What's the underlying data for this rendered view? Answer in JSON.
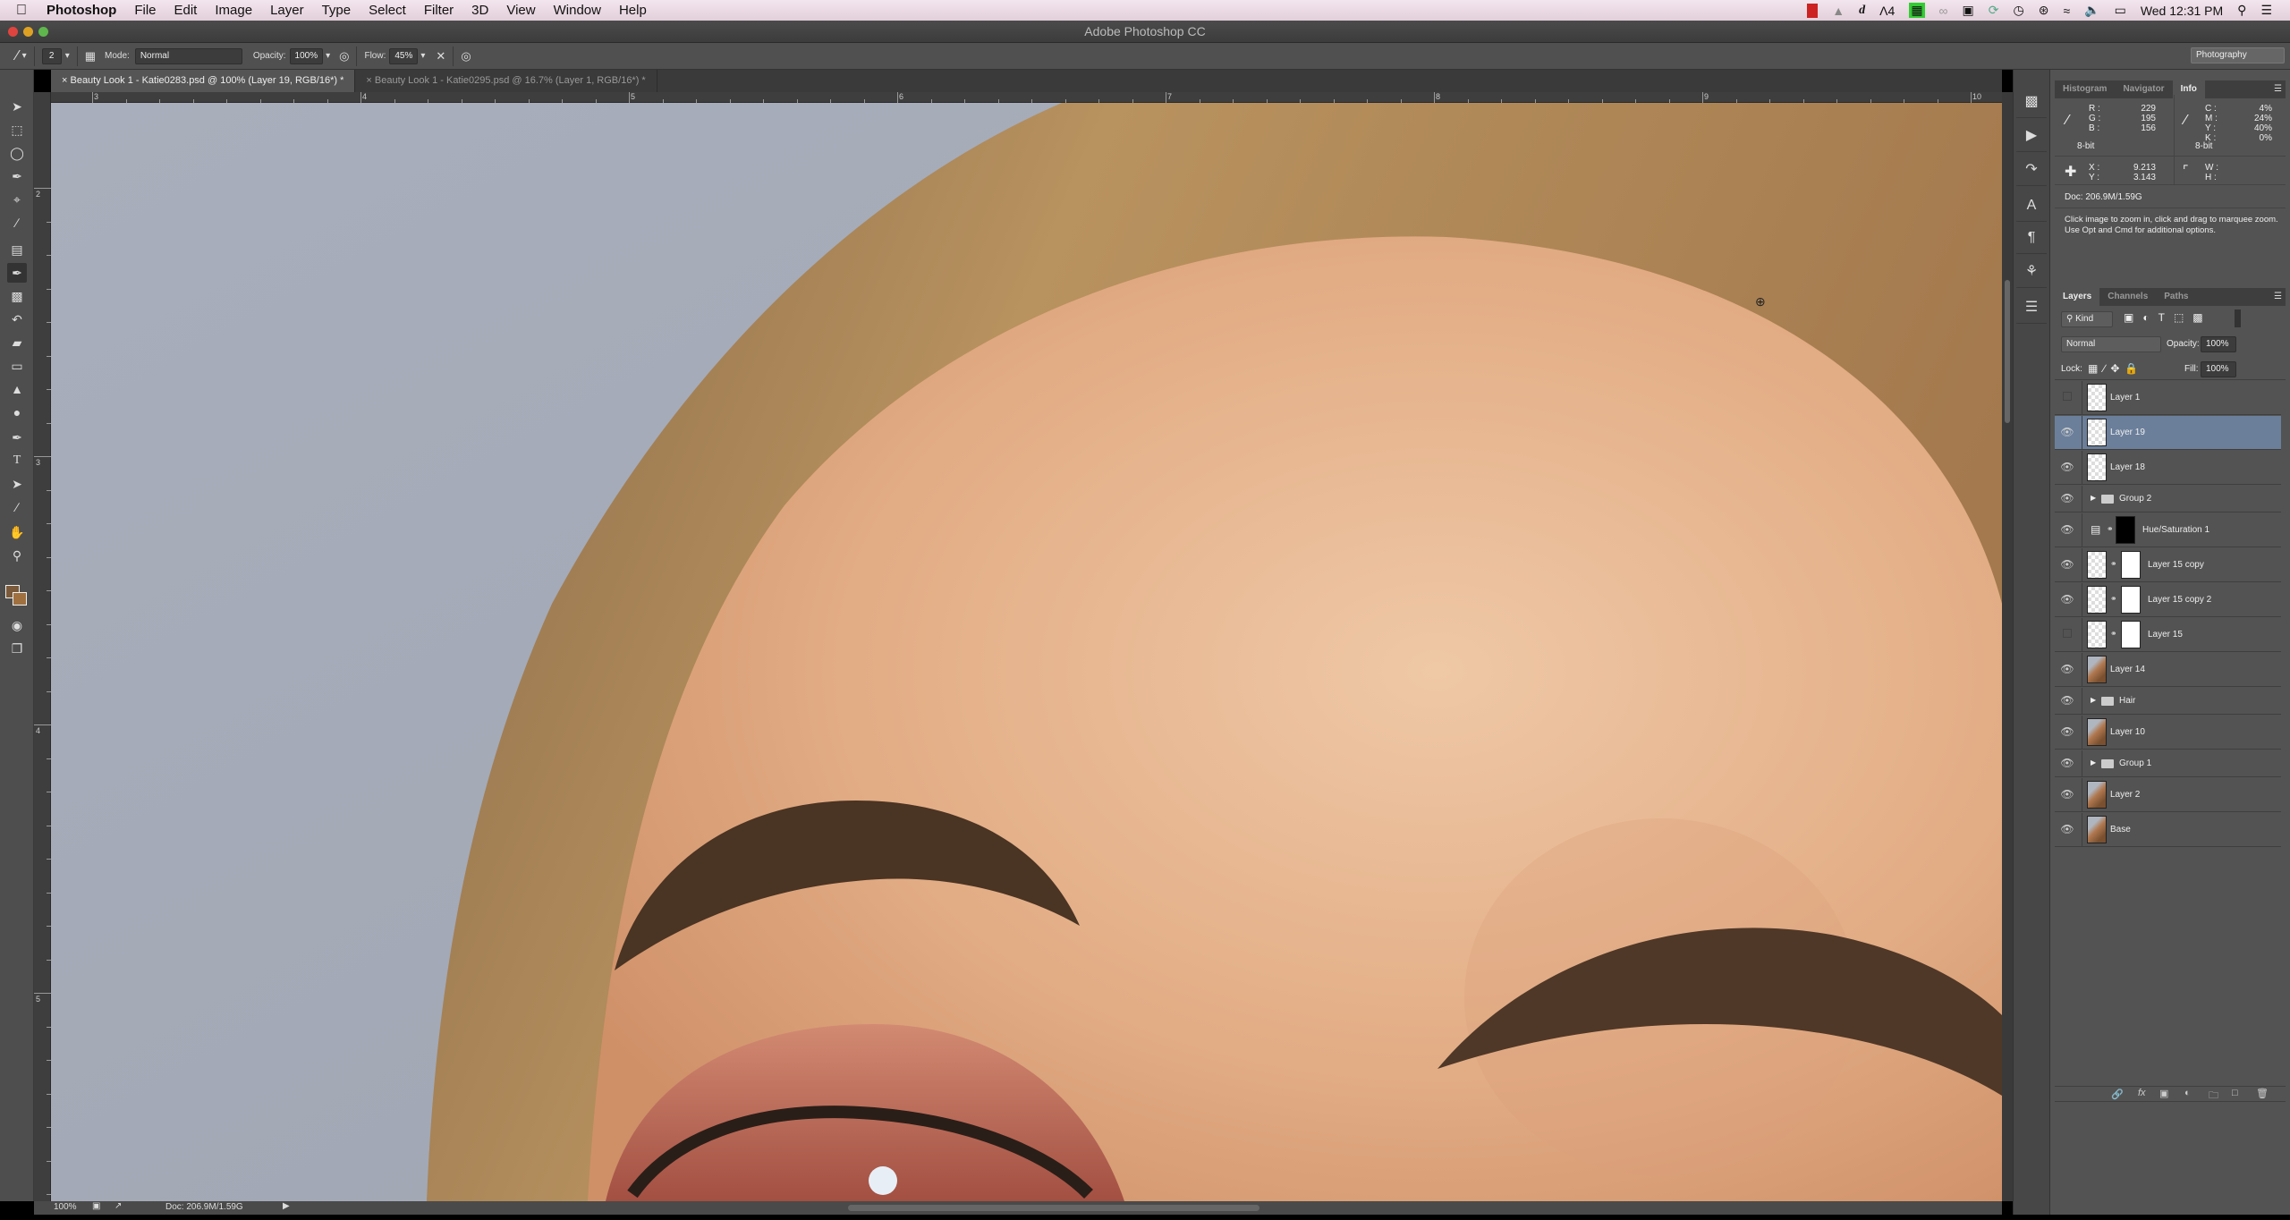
{
  "menubar": {
    "app": "Photoshop",
    "items": [
      "File",
      "Edit",
      "Image",
      "Layer",
      "Type",
      "Select",
      "Filter",
      "3D",
      "View",
      "Window",
      "Help"
    ],
    "status_icons": [
      "recording-icon",
      "notification-icon",
      "dictionary-icon",
      "adobe-icon",
      "activity-icon",
      "creative-cloud-icon",
      "display-icon",
      "sync-icon",
      "time-machine-icon",
      "bluetooth-icon",
      "wifi-icon",
      "volume-icon",
      "battery-icon"
    ],
    "adobe_badge": "4",
    "clock": "Wed 12:31 PM"
  },
  "window": {
    "title": "Adobe Photoshop CC"
  },
  "options": {
    "brush_size": "2",
    "mode_label": "Mode:",
    "mode_value": "Normal",
    "opacity_label": "Opacity:",
    "opacity_value": "100%",
    "flow_label": "Flow:",
    "flow_value": "45%",
    "workspace": "Photography"
  },
  "tabs": [
    {
      "label": "Beauty Look 1 - Katie0283.psd @ 100% (Layer 19, RGB/16*) *",
      "active": true
    },
    {
      "label": "Beauty Look 1 - Katie0295.psd @ 16.7% (Layer 1, RGB/16*) *",
      "active": false
    }
  ],
  "rulers": {
    "top": [
      "3",
      "4",
      "5",
      "6",
      "7",
      "8",
      "9",
      "10"
    ],
    "left": [
      "2",
      "3",
      "4",
      "5"
    ]
  },
  "colors": {
    "foreground": "#7a5a3a",
    "background": "#a0703f",
    "selection": "#6b7f9b"
  },
  "status": {
    "zoom": "100%",
    "doc": "Doc: 206.9M/1.59G"
  },
  "info_panel": {
    "tabs": [
      "Histogram",
      "Navigator",
      "Info"
    ],
    "active_tab": "Info",
    "rgb": {
      "labels": [
        "R :",
        "G :",
        "B :"
      ],
      "values": [
        "229",
        "195",
        "156"
      ],
      "bits": "8-bit"
    },
    "cmyk": {
      "labels": [
        "C :",
        "M :",
        "Y :",
        "K :"
      ],
      "values": [
        "4%",
        "24%",
        "40%",
        "0%"
      ],
      "bits": "8-bit"
    },
    "xy": {
      "labels": [
        "X :",
        "Y :"
      ],
      "values": [
        "9.213",
        "3.143"
      ]
    },
    "wh": {
      "labels": [
        "W :",
        "H :"
      ]
    },
    "doc": "Doc: 206.9M/1.59G",
    "hint": "Click image to zoom in, click and drag to marquee zoom.  Use Opt and Cmd for additional options."
  },
  "layers_panel": {
    "tabs": [
      "Layers",
      "Channels",
      "Paths"
    ],
    "filter": "Kind",
    "blend_mode": "Normal",
    "opacity_label": "Opacity:",
    "opacity_value": "100%",
    "lock_label": "Lock:",
    "fill_label": "Fill:",
    "fill_value": "100%",
    "layers": [
      {
        "name": "Layer 1",
        "visible": false,
        "type": "pixel"
      },
      {
        "name": "Layer 19",
        "visible": true,
        "type": "pixel",
        "selected": true
      },
      {
        "name": "Layer 18",
        "visible": true,
        "type": "pixel"
      },
      {
        "name": "Group 2",
        "visible": true,
        "type": "group"
      },
      {
        "name": "Hue/Saturation 1",
        "visible": true,
        "type": "adjustment"
      },
      {
        "name": "Layer 15 copy",
        "visible": true,
        "type": "masked"
      },
      {
        "name": "Layer 15 copy 2",
        "visible": true,
        "type": "masked"
      },
      {
        "name": "Layer 15",
        "visible": false,
        "type": "masked"
      },
      {
        "name": "Layer 14",
        "visible": true,
        "type": "photo"
      },
      {
        "name": "Hair",
        "visible": true,
        "type": "group"
      },
      {
        "name": "Layer 10",
        "visible": true,
        "type": "photo"
      },
      {
        "name": "Group 1",
        "visible": true,
        "type": "group"
      },
      {
        "name": "Layer 2",
        "visible": true,
        "type": "photo"
      },
      {
        "name": "Base",
        "visible": true,
        "type": "photo"
      }
    ]
  }
}
